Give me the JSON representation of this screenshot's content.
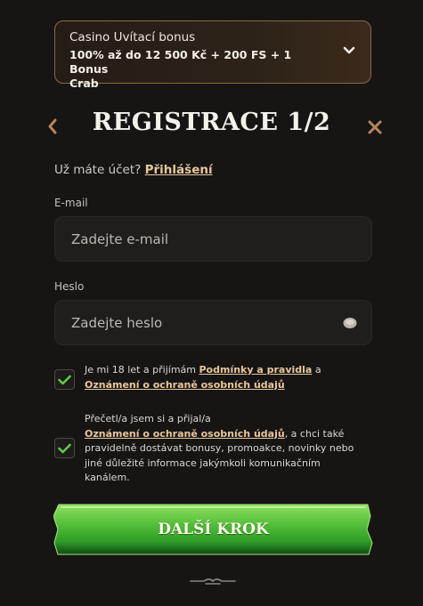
{
  "bonus": {
    "title": "Casino Uvítací bonus",
    "offer_line1": "100% až do 12 500 Kč + 200 FS + 1 Bonus",
    "offer_line2": "Crab",
    "chevron_icon": "chevron-down-icon"
  },
  "header": {
    "title": "REGISTRACE 1/2",
    "back_icon": "chevron-left-icon",
    "close_icon": "close-icon"
  },
  "login": {
    "prompt": "Už máte účet?",
    "link": "Přihlášení"
  },
  "email": {
    "label": "E-mail",
    "placeholder": "Zadejte e-mail",
    "value": ""
  },
  "password": {
    "label": "Heslo",
    "placeholder": "Zadejte heslo",
    "value": "",
    "eye_icon": "eye-icon"
  },
  "consent1": {
    "checked": true,
    "text_before": "Je mi 18 let a přijímám",
    "link1": "Podmínky a pravidla",
    "text_mid": "a",
    "link2": "Oznámení o ochraně osobních údajů"
  },
  "consent2": {
    "checked": true,
    "text_line1": "Přečetl/a jsem si a přijal/a",
    "link": "Oznámení o ochraně osobních údajů",
    "text_after": ", a chci také pravidelně dostávat bonusy, promoakce, novinky nebo jiné důležité informace jakýmkoli komunikačním kanálem."
  },
  "cta": {
    "label": "DALŠÍ KROK"
  },
  "colors": {
    "background": "#161514",
    "accent_gold": "#e8c79b",
    "check_green": "#5ecb45",
    "cta_green": "#3aa52c",
    "icon_brown": "#b7845a"
  }
}
